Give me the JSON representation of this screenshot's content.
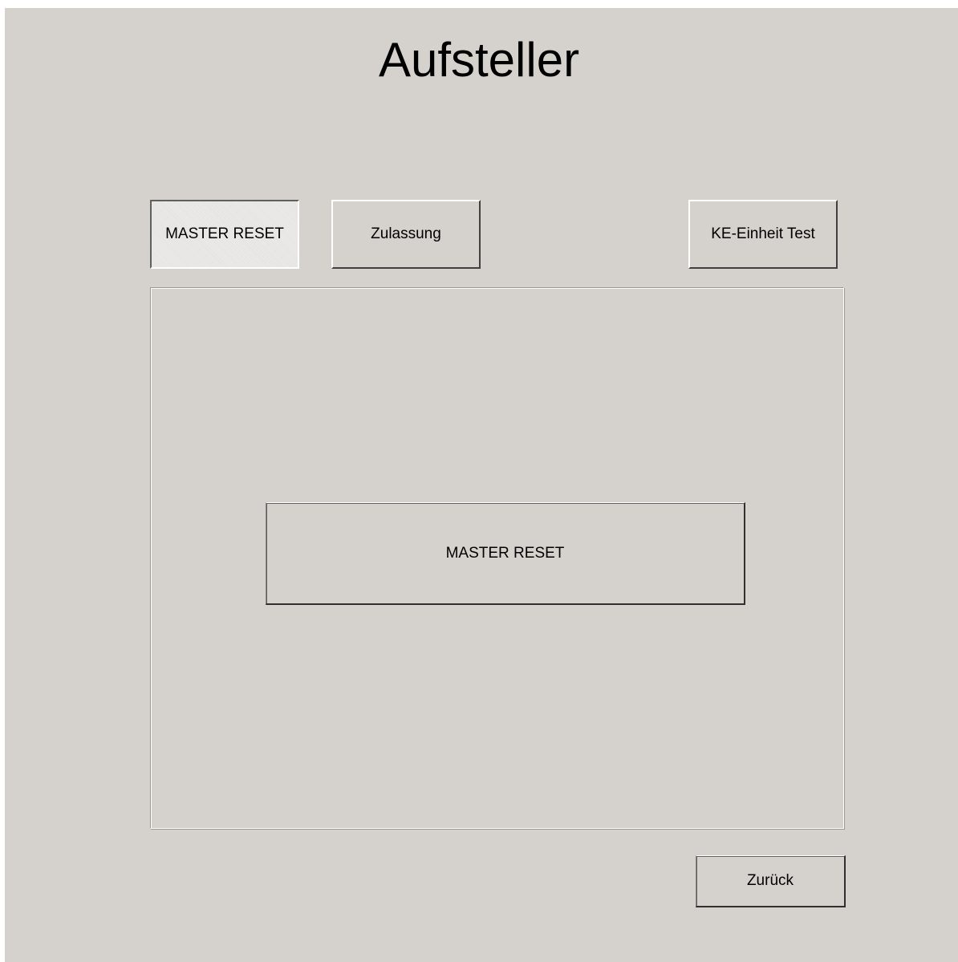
{
  "window": {
    "title": "Aufsteller"
  },
  "tabs": [
    {
      "label": "MASTER RESET",
      "active": true
    },
    {
      "label": "Zulassung",
      "active": false
    },
    {
      "label": "KE-Einheit Test",
      "active": false
    }
  ],
  "content": {
    "action_button_label": "MASTER RESET"
  },
  "footer": {
    "back_label": "Zurück"
  },
  "colors": {
    "background": "#d5d2cd",
    "text": "#000000"
  }
}
